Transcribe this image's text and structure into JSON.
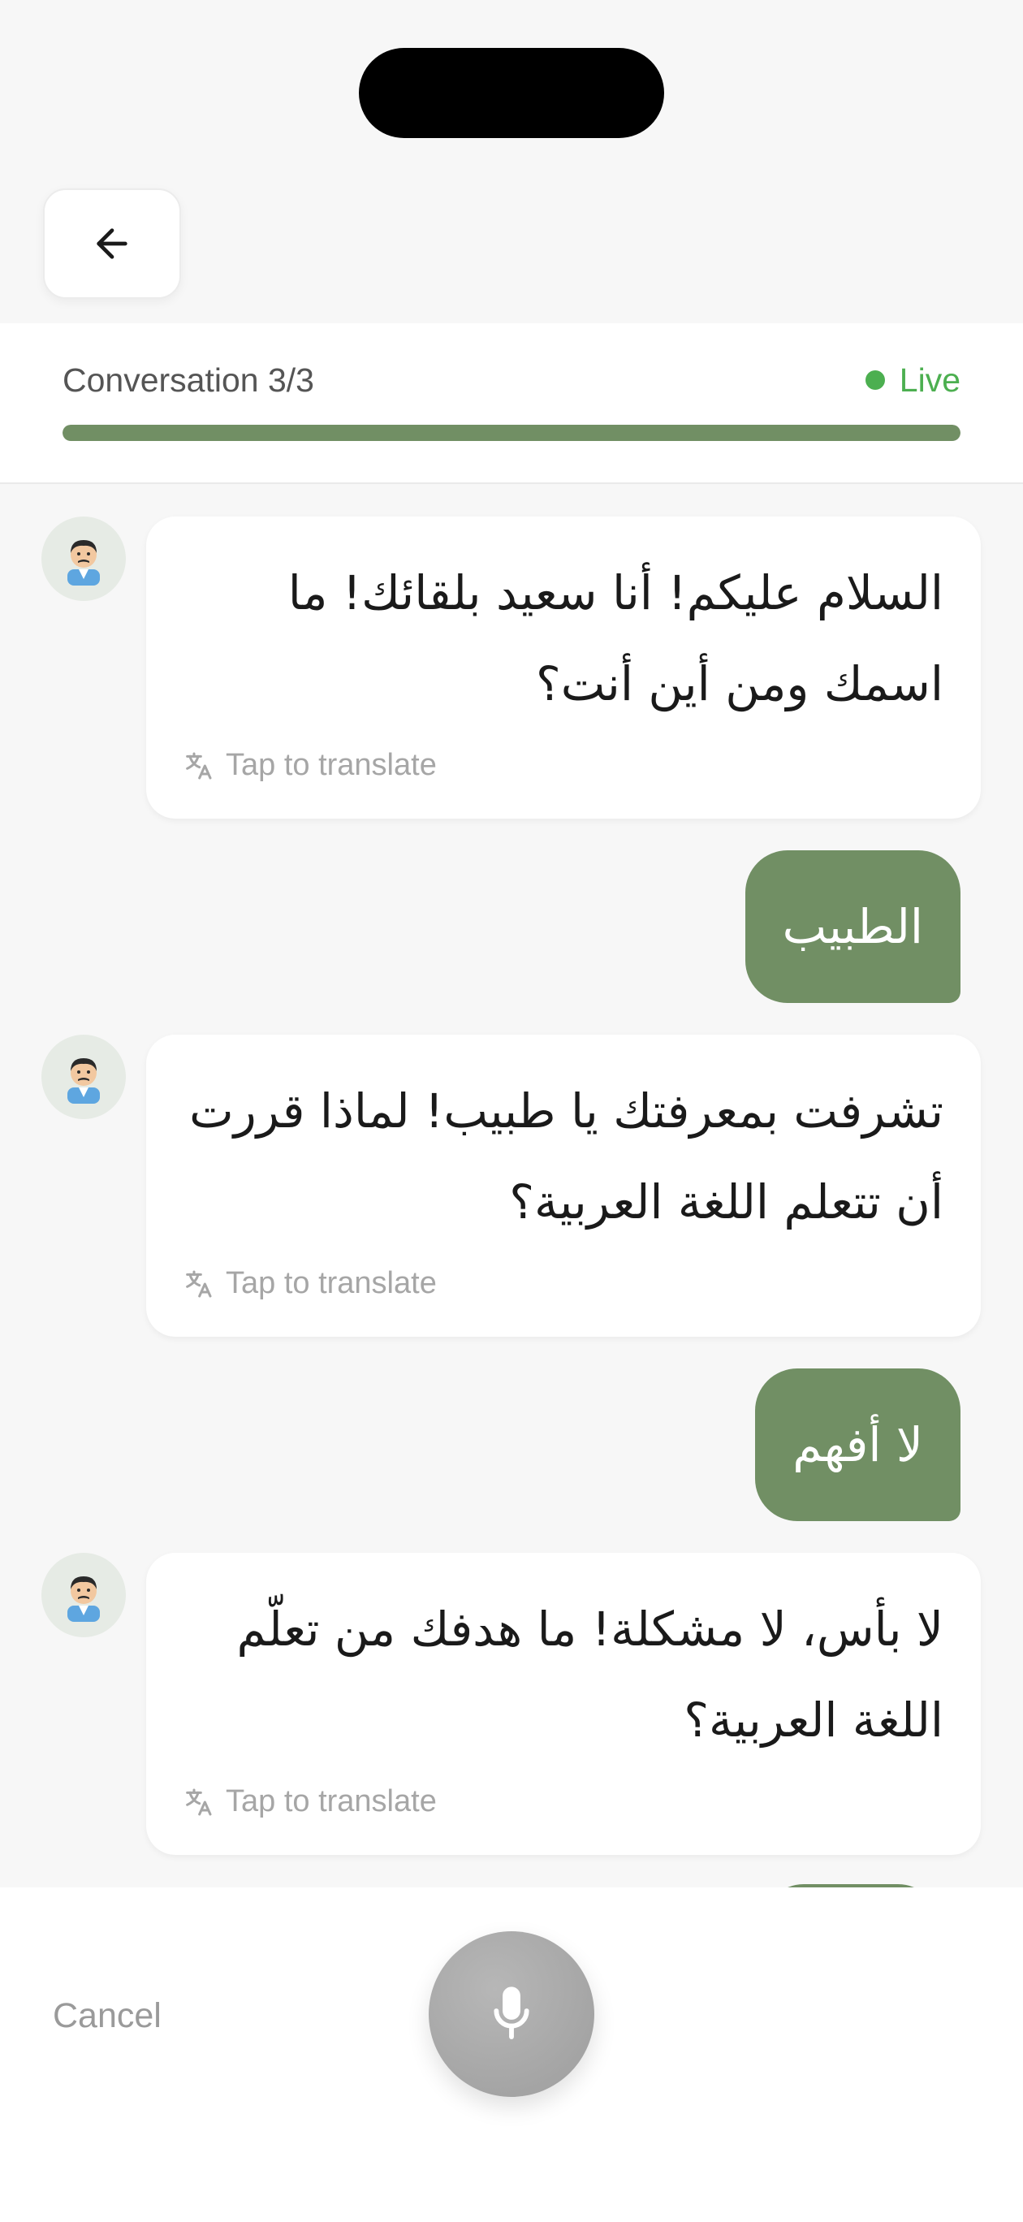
{
  "header": {
    "back_label": "back",
    "conversation_label": "Conversation 3/3",
    "status_label": "Live",
    "progress": 1.0,
    "accent_color": "#718f64",
    "live_color": "#4caf50"
  },
  "messages": [
    {
      "role": "bot",
      "text": "السلام عليكم! أنا سعيد بلقائك! ما اسمك ومن أين أنت؟",
      "translate_label": "Tap to translate",
      "avatar_icon": "man-avatar-icon"
    },
    {
      "role": "user",
      "text": "الطبيب"
    },
    {
      "role": "bot",
      "text": "تشرفت بمعرفتك يا طبيب! لماذا قررت أن تتعلم اللغة العربية؟",
      "translate_label": "Tap to translate",
      "avatar_icon": "man-avatar-icon"
    },
    {
      "role": "user",
      "text": "لا أفهم"
    },
    {
      "role": "bot",
      "text": "لا بأس، لا مشكلة! ما هدفك من تعلّم اللغة العربية؟",
      "translate_label": "Tap to translate",
      "avatar_icon": "man-avatar-icon"
    }
  ],
  "footer": {
    "cancel_label": "Cancel",
    "mic_icon": "microphone-icon"
  }
}
